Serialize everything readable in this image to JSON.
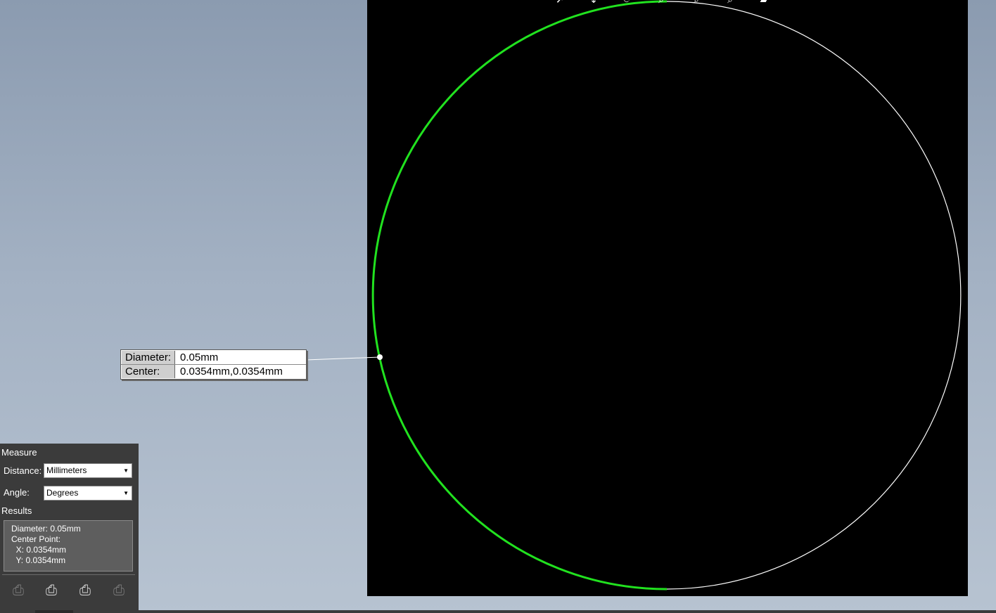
{
  "toolbar": {
    "icons": [
      "select-arrow-icon",
      "pan-icon",
      "rotate-icon",
      "zoom-window-icon",
      "zoom-in-icon",
      "zoom-out-icon",
      "view-icon"
    ]
  },
  "callout": {
    "diameter_label": "Diameter:",
    "diameter_value": "0.05mm",
    "center_label": "Center:",
    "center_value": "0.0354mm,0.0354mm"
  },
  "measure_panel": {
    "title": "Measure",
    "distance_label": "Distance:",
    "distance_value": "Millimeters",
    "angle_label": "Angle:",
    "angle_value": "Degrees",
    "results_title": "Results",
    "results": {
      "diameter": "Diameter: 0.05mm",
      "center_point": "Center Point:",
      "x": "  X: 0.0354mm",
      "y": "  Y: 0.0354mm"
    }
  },
  "colors": {
    "selection": "#21e21f",
    "geometry": "#ffffff",
    "viewport_bg": "#000000",
    "panel_bg": "#3b3b3b"
  }
}
